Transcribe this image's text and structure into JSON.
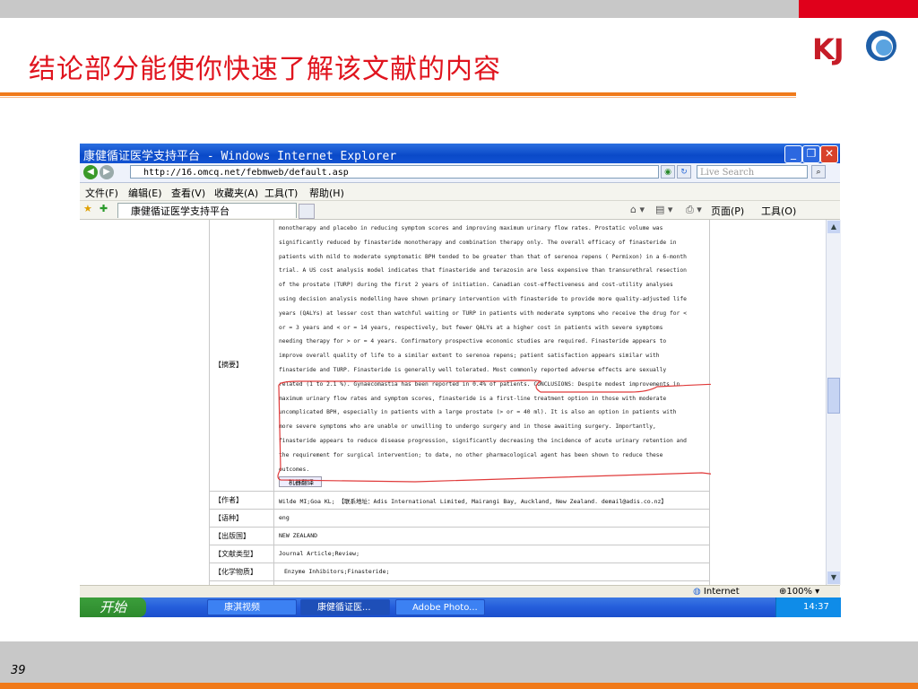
{
  "slide": {
    "title": "结论部分能使你快速了解该文献的内容",
    "logo_text": "KJ",
    "page_number": "39",
    "colors": {
      "title": "#e0141e",
      "accent_line": "#f07a1a",
      "header_red": "#e0001b"
    }
  },
  "browser": {
    "window_title": "康健循证医学支持平台 - Windows Internet Explorer",
    "address": "http://16.omcq.net/febmweb/default.asp",
    "search_placeholder": "Live Search",
    "menu": [
      "文件(F)",
      "编辑(E)",
      "查看(V)",
      "收藏夹(A)",
      "工具(T)",
      "帮助(H)"
    ],
    "tab_label": "康健循证医学支持平台",
    "toolbar_right": {
      "page": "页面(P)",
      "tools": "工具(O)"
    },
    "status_zone": "Internet",
    "zoom": "100%"
  },
  "record": {
    "abstract_label": "【摘要】",
    "abstract_lines": [
      "monotherapy and placebo in reducing symptom scores and improving maximum urinary flow rates. Prostatic volume was",
      "significantly reduced by finasteride monotherapy and combination therapy only. The overall efficacy of finasteride in",
      "patients with mild to moderate symptomatic BPH tended to be greater than that of serenoa repens ( Permixon) in a 6-month",
      "trial. A US cost analysis model indicates that finasteride and terazosin are less expensive than transurethral resection",
      "of the prostate (TURP) during the first 2 years of initiation. Canadian cost-effectiveness and cost-utility analyses",
      "using decision analysis modelling have shown primary intervention with finasteride to provide more quality-adjusted life",
      "years (QALYs) at lesser cost than watchful waiting or TURP in patients with moderate symptoms who receive the drug for <",
      "or = 3 years and < or = 14 years, respectively, but fewer QALYs at a higher cost in patients with severe symptoms",
      "needing therapy for > or = 4 years. Confirmatory prospective economic studies are required. Finasteride appears to",
      "improve overall quality of life to a similar extent to serenoa repens; patient satisfaction appears similar with",
      "finasteride and TURP. Finasteride is generally well tolerated. Most commonly reported adverse effects are sexually",
      "related (1 to 2.1 %). Gynaecomastia has been reported in 0.4% of patients. CONCLUSIONS: Despite modest improvements in",
      "maximum urinary flow rates and symptom scores, finasteride is a first-line treatment option in those with moderate",
      "uncomplicated BPH, especially in patients with a large prostate (> or = 40 ml). It is also an option in patients with",
      "more severe symptoms who are unable or unwilling to undergo surgery and in those awaiting surgery. Importantly,",
      "finasteride appears to reduce disease progression, significantly decreasing the incidence of acute urinary retention and",
      "the requirement for surgical intervention; to date, no other pharmacological agent has been shown to reduce these",
      "outcomes."
    ],
    "translate_button": "机器翻译",
    "author_label": "【作者】",
    "author_value": "Wilde MI;Goa KL;    【联系地址：Adis International Limited, Mairangi Bay, Auckland, New Zealand. demail@adis.co.nz】",
    "language_label": "【语种】",
    "language_value": "eng",
    "country_label": "【出版国】",
    "country_value": "NEW ZEALAND",
    "doctype_label": "【文献类型】",
    "doctype_value": "Journal Article;Review;",
    "chem_label": "【化学物质】",
    "chem_value": "Enzyme Inhibitors;Finasteride;"
  },
  "taskbar": {
    "start": "开始",
    "tasks": [
      "康淇视频",
      "康健循证医...",
      "Adobe Photo..."
    ],
    "clock": "14:37"
  }
}
